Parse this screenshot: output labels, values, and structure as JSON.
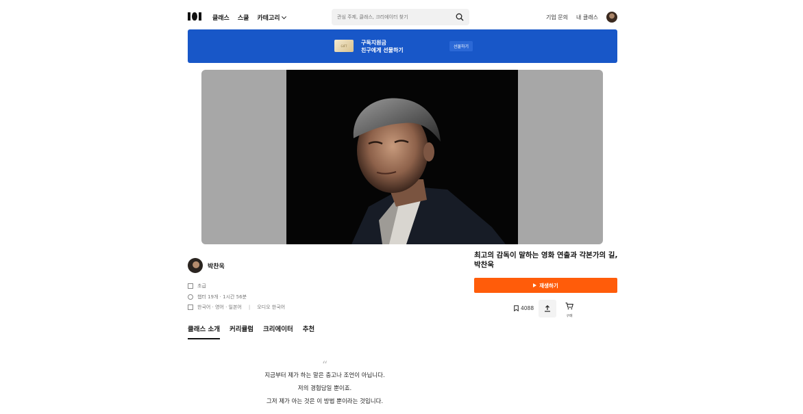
{
  "header": {
    "nav": [
      "클래스",
      "스쿨",
      "카테고리"
    ],
    "search_placeholder": "관심 주제, 클래스, 크리에이터 찾기",
    "right_links": [
      "기업 문의",
      "내 클래스"
    ]
  },
  "banner": {
    "card_label": "GIFT",
    "line1": "구독지원금",
    "line2": "친구에게 선물하기",
    "button": "선물하기"
  },
  "instructor": {
    "name": "박찬욱"
  },
  "meta": {
    "level": "초급",
    "duration": "챕터 19개 · 1시간 56분",
    "subtitles": "한국어 · 영어 · 일본어",
    "audio": "오디오 한국어"
  },
  "tabs": [
    "클래스 소개",
    "커리큘럼",
    "크리에이터",
    "추천"
  ],
  "course": {
    "title": "최고의 감독이 말하는 영화 연출과 각본가의 길, 박찬욱",
    "play_label": "재생하기",
    "bookmark_count": "4088",
    "cart_label": "구매"
  },
  "quote": {
    "mark": "“",
    "lines": [
      "지금부터 제가 하는 말은 충고나 조언이 아닙니다.",
      "저의 경험담일 뿐이죠.",
      "그저 제가 아는 것은 이 방법 뿐이라는 것입니다."
    ]
  },
  "colors": {
    "banner": "#1857c8",
    "play": "#ff5c0a"
  }
}
